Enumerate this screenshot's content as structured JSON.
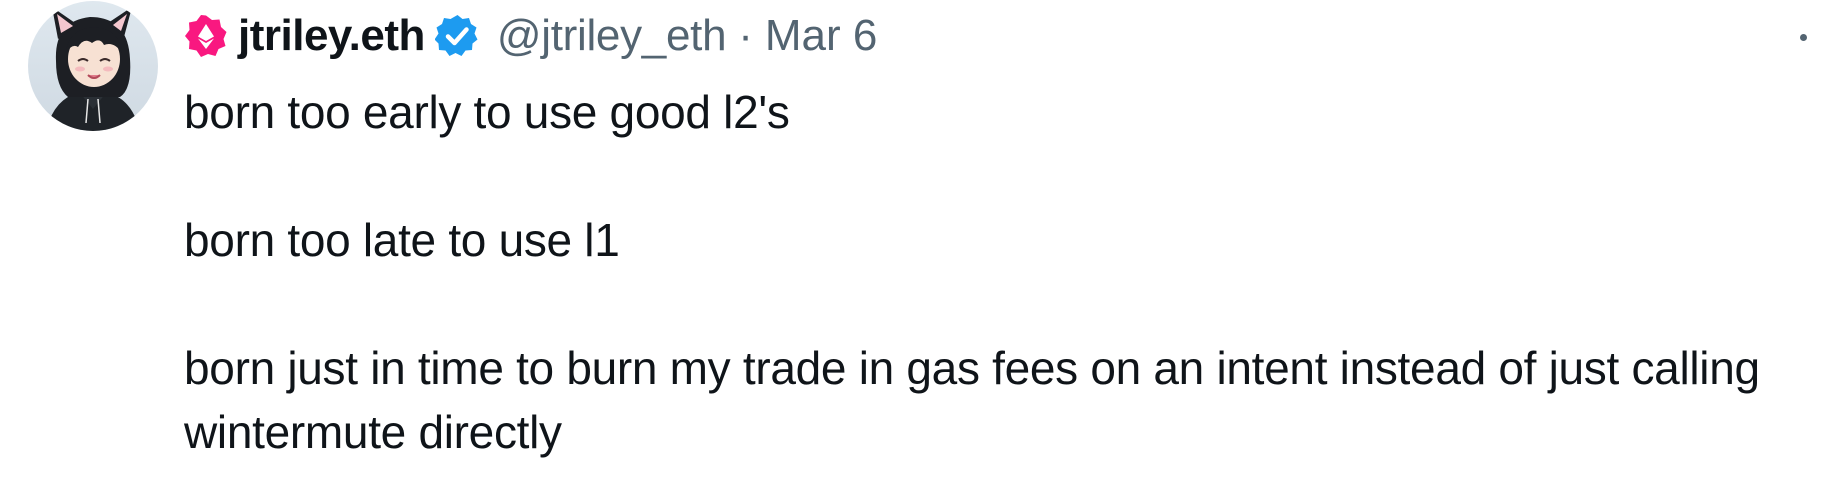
{
  "tweet": {
    "author": {
      "display_name": "jtriley.eth",
      "handle": "@jtriley_eth",
      "avatar_icon": "anime-avatar",
      "badge_icon": "ethereum-diamond-icon",
      "verified_icon": "verified-badge-icon",
      "badge_color": "#f91880",
      "verified_color": "#1d9bf0"
    },
    "separator": "·",
    "timestamp": "Mar 6",
    "paragraphs": [
      "born too early to use good l2's",
      "born too late to use l1",
      "born just in time to burn my trade in gas fees on an intent instead of just calling wintermute directly"
    ],
    "more_icon": "more-dots-icon"
  },
  "colors": {
    "text_primary": "#0f1419",
    "text_secondary": "#536471",
    "background": "#ffffff"
  }
}
